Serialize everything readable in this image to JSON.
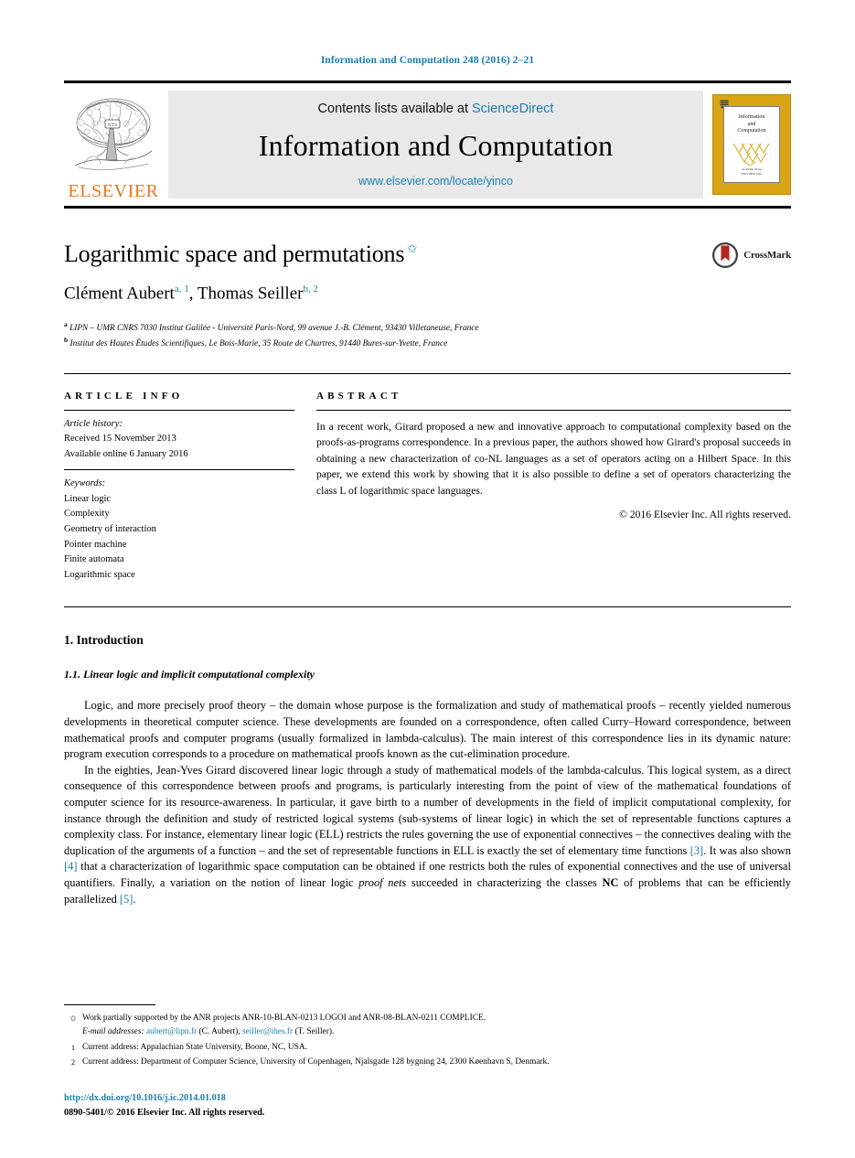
{
  "running_head": "Information and Computation 248 (2016) 2–21",
  "masthead": {
    "publisher_name": "ELSEVIER",
    "contents_prefix": "Contents lists available at ",
    "contents_link": "ScienceDirect",
    "journal_title": "Information and Computation",
    "journal_url": "www.elsevier.com/locate/yinco",
    "cover": {
      "title_line1": "Information",
      "title_line2": "and",
      "title_line3": "Computation",
      "footer_line1": "Academic Press",
      "footer_line2": "ISSN 0890-5401"
    }
  },
  "article": {
    "title": "Logarithmic space and permutations",
    "title_footnote_mark": "✩",
    "authors_html": "Clément Aubert<sup>a, 1</sup>, Thomas Seiller<sup>b, 2</sup>",
    "affiliations": [
      {
        "mark": "a",
        "text": "LIPN – UMR CNRS 7030 Institut Galilée - Université Paris-Nord, 99 avenue J.-B. Clément, 93430 Villetaneuse, France"
      },
      {
        "mark": "b",
        "text": "Institut des Hautes Études Scientifiques, Le Bois-Marie, 35 Route de Chartres, 91440 Bures-sur-Yvette, France"
      }
    ],
    "crossmark_label": "CrossMark"
  },
  "article_info": {
    "heading": "ARTICLE INFO",
    "history_label": "Article history:",
    "history_lines": [
      "Received 15 November 2013",
      "Available online 6 January 2016"
    ],
    "keywords_label": "Keywords:",
    "keywords": [
      "Linear logic",
      "Complexity",
      "Geometry of interaction",
      "Pointer machine",
      "Finite automata",
      "Logarithmic space"
    ]
  },
  "abstract": {
    "heading": "ABSTRACT",
    "text": "In a recent work, Girard proposed a new and innovative approach to computational complexity based on the proofs-as-programs correspondence. In a previous paper, the authors showed how Girard's proposal succeeds in obtaining a new characterization of co-NL languages as a set of operators acting on a Hilbert Space. In this paper, we extend this work by showing that it is also possible to define a set of operators characterizing the class L of logarithmic space languages.",
    "copyright": "© 2016 Elsevier Inc. All rights reserved."
  },
  "body": {
    "section_heading": "1. Introduction",
    "subsection_heading": "1.1. Linear logic and implicit computational complexity",
    "paragraph_1": "Logic, and more precisely proof theory – the domain whose purpose is the formalization and study of mathematical proofs – recently yielded numerous developments in theoretical computer science. These developments are founded on a correspondence, often called Curry–Howard correspondence, between mathematical proofs and computer programs (usually formalized in lambda-calculus). The main interest of this correspondence lies in its dynamic nature: program execution corresponds to a procedure on mathematical proofs known as the cut-elimination procedure.",
    "paragraph_2_a": "In the eighties, Jean-Yves Girard discovered linear logic through a study of mathematical models of the lambda-calculus. This logical system, as a direct consequence of this correspondence between proofs and programs, is particularly interesting from the point of view of the mathematical foundations of computer science for its resource-awareness. In particular, it gave birth to a number of developments in the field of implicit computational complexity, for instance through the definition and study of restricted logical systems (sub-systems of linear logic) in which the set of representable functions captures a complexity class. For instance, elementary linear logic (ELL) restricts the rules governing the use of exponential connectives – the connectives dealing with the duplication of the arguments of a function – and the set of representable functions in ELL is exactly the set of elementary time functions ",
    "paragraph_2_ref1": "[3]",
    "paragraph_2_b": ". It was also shown ",
    "paragraph_2_ref2": "[4]",
    "paragraph_2_c": " that a characterization of logarithmic space computation can be obtained if one restricts both the rules of exponential connectives and the use of universal quantifiers. Finally, a variation on the notion of linear logic ",
    "paragraph_2_italic": "proof nets",
    "paragraph_2_d": " succeeded in characterizing the classes ",
    "paragraph_2_bold": "NC",
    "paragraph_2_e": " of problems that can be efficiently parallelized ",
    "paragraph_2_ref3": "[5]",
    "paragraph_2_f": "."
  },
  "footnotes": [
    {
      "mark": "✩",
      "line1": "Work partially supported by the ANR projects ANR-10-BLAN-0213 LOGOI and ANR-08-BLAN-0211 COMPLICE.",
      "email_label": "E-mail addresses:",
      "email1": "aubert@lipn.fr",
      "email1_owner": " (C. Aubert), ",
      "email2": "seiller@ihes.fr",
      "email2_owner": " (T. Seiller)."
    },
    {
      "mark": "1",
      "line1": "Current address: Appalachian State University, Boone, NC, USA."
    },
    {
      "mark": "2",
      "line1": "Current address: Department of Computer Science, University of Copenhagen, Njalsgade 128 bygning 24, 2300 Køenhavn S, Denmark."
    }
  ],
  "colophon": {
    "doi": "http://dx.doi.org/10.1016/j.ic.2014.01.018",
    "issn_line": "0890-5401/© 2016 Elsevier Inc. All rights reserved."
  },
  "colors": {
    "link": "#1a7eb0",
    "elsevier_orange": "#E87722",
    "cover_gold": "#D9A514"
  }
}
